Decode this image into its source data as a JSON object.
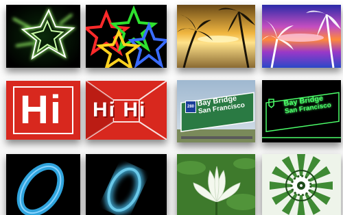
{
  "tiles": {
    "hi_plain": {
      "text": "Hi"
    },
    "hi_extruded": {
      "text": "Hi Hi"
    },
    "sign": {
      "route": "280",
      "line1": "Bay Bridge",
      "line2": "San Francisco"
    },
    "sign_glow": {
      "line1": "Bay Bridge",
      "line2": "San Francisco"
    }
  },
  "colors": {
    "hi_red": "#d8281e",
    "sign_green": "#2a7a43",
    "glow_green": "#4cff6a",
    "ring_blue": "#2fa3dc"
  }
}
